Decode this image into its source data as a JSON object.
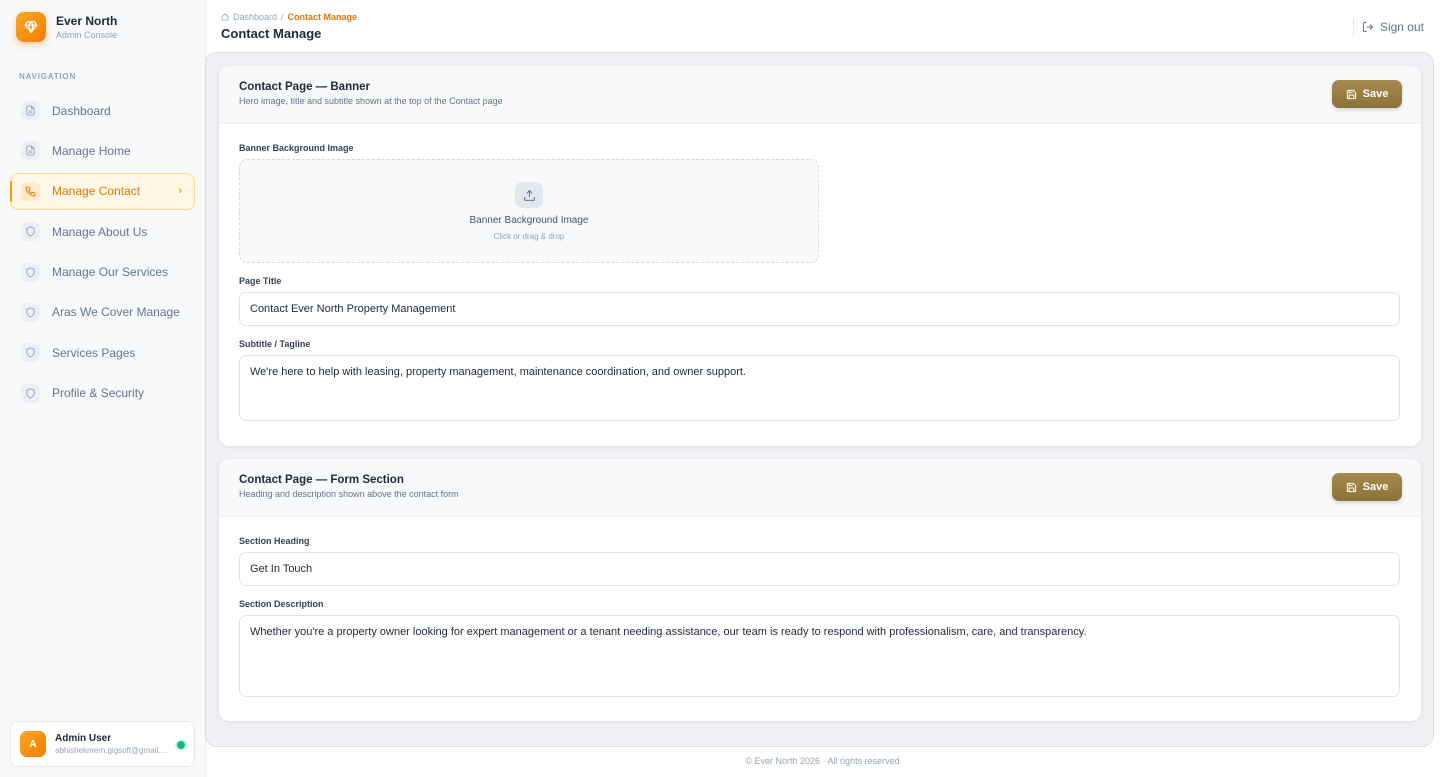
{
  "brand": {
    "name": "Ever North",
    "subtitle": "Admin Console"
  },
  "navigation": {
    "label": "NAVIGATION",
    "items": [
      {
        "label": "Dashboard",
        "icon": "document-icon",
        "active": false
      },
      {
        "label": "Manage Home",
        "icon": "document-icon",
        "active": false
      },
      {
        "label": "Manage Contact",
        "icon": "phone-icon",
        "active": true
      },
      {
        "label": "Manage About Us",
        "icon": "shield-icon",
        "active": false
      },
      {
        "label": "Manage Our Services",
        "icon": "shield-icon",
        "active": false
      },
      {
        "label": "Aras We Cover Manage",
        "icon": "shield-icon",
        "active": false
      },
      {
        "label": "Services Pages",
        "icon": "shield-icon",
        "active": false
      },
      {
        "label": "Profile & Security",
        "icon": "shield-icon",
        "active": false
      }
    ]
  },
  "user": {
    "initial": "A",
    "name": "Admin User",
    "email": "abhishekmern.gigsoft@gmail.com",
    "status": "online"
  },
  "header": {
    "breadcrumb": {
      "home": "Dashboard",
      "separator": "/",
      "current": "Contact Manage"
    },
    "title": "Contact Manage",
    "signout_label": "Sign out"
  },
  "banner_section": {
    "title": "Contact Page — Banner",
    "subtitle": "Hero image, title and subtitle shown at the top of the Contact page",
    "save_label": "Save",
    "image_label": "Banner Background Image",
    "dropzone_title": "Banner Background Image",
    "dropzone_hint": "Click or drag & drop",
    "page_title_label": "Page Title",
    "page_title_value": "Contact Ever North Property Management",
    "subtitle_label": "Subtitle / Tagline",
    "subtitle_value": "We're here to help with leasing, property management, maintenance coordination, and owner support."
  },
  "form_section": {
    "title": "Contact Page — Form Section",
    "subtitle": "Heading and description shown above the contact form",
    "save_label": "Save",
    "heading_label": "Section Heading",
    "heading_value": "Get In Touch",
    "description_label": "Section Description",
    "description_value": "Whether you're a property owner looking for expert management or a tenant needing assistance, our team is ready to respond with professionalism, care, and transparency."
  },
  "footer": {
    "text": "© Ever North 2026 · All rights reserved"
  },
  "colors": {
    "accent": "#d97706",
    "save_button": "#9a7f44",
    "online": "#10b981"
  }
}
